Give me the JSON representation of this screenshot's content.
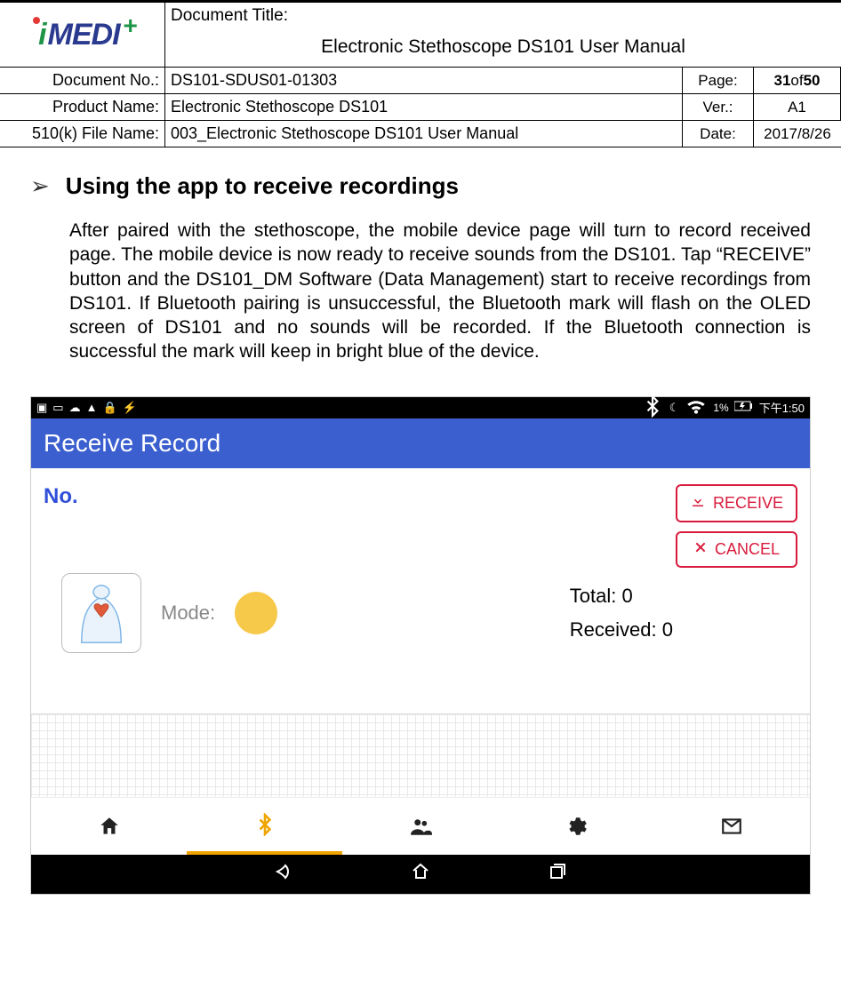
{
  "header": {
    "title_label": "Document Title:",
    "title_value": "Electronic Stethoscope DS101 User Manual",
    "docno_label": "Document No.:",
    "docno_value": "DS101-SDUS01-01303",
    "page_label": "Page:",
    "page_value_bold": "31",
    "page_value_of": " of ",
    "page_value_total": "50",
    "product_label": "Product Name:",
    "product_value": "Electronic Stethoscope DS101",
    "ver_label": "Ver.:",
    "ver_value": "A1",
    "file_label": "510(k) File Name:",
    "file_value": "003_Electronic Stethoscope DS101 User Manual",
    "date_label": "Date:",
    "date_value": "2017/8/26",
    "logo_text_i": "i",
    "logo_text_rest": "MEDI",
    "logo_plus": "+"
  },
  "body": {
    "bullet": "➢",
    "heading": "Using the app to receive recordings",
    "paragraph": "After paired with the stethoscope, the mobile device page will turn to record received page. The mobile device is now ready to receive sounds from the DS101. Tap “RECEIVE” button and the DS101_DM Software (Data Management) start to receive recordings from DS101. If Bluetooth pairing is unsuccessful, the Bluetooth mark will flash on the OLED screen of DS101 and no sounds will be recorded. If the Bluetooth connection is successful the mark will keep in bright blue of the device."
  },
  "phone": {
    "status_battery_pct": "1%",
    "status_time": "下午1:50",
    "appbar_title": "Receive Record",
    "no_label": "No.",
    "receive_btn": "RECEIVE",
    "cancel_btn": "CANCEL",
    "mode_label": "Mode:",
    "total_label": "Total: ",
    "total_value": "0",
    "received_label": "Received: ",
    "received_value": "0"
  }
}
